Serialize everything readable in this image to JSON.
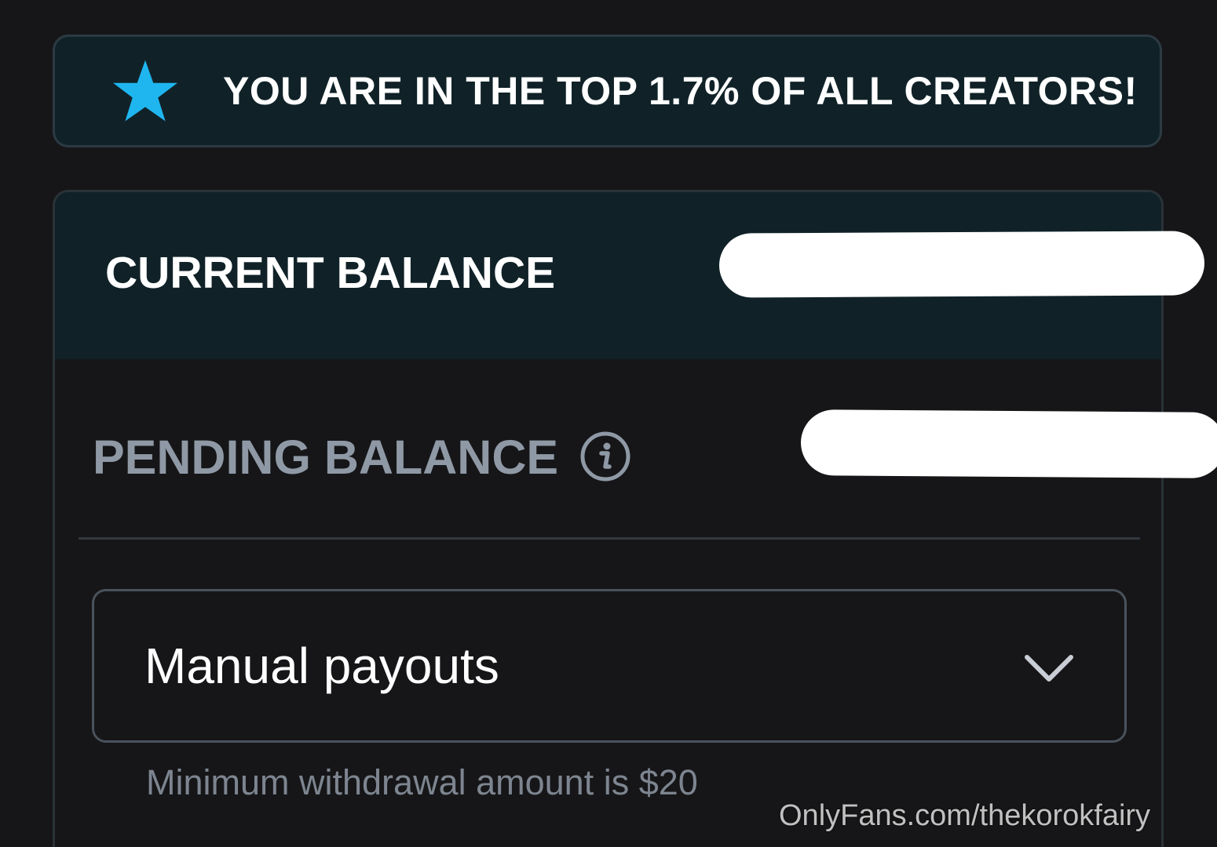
{
  "colors": {
    "background": "#161618",
    "banner_background": "#102228",
    "accent_star": "#1fb6f0",
    "pending_label": "#8f99a6"
  },
  "rank_banner": {
    "icon": "star-icon",
    "text": "YOU ARE IN THE TOP 1.7% OF ALL CREATORS!"
  },
  "balance": {
    "current_label": "CURRENT BALANCE",
    "pending_label": "PENDING BALANCE",
    "pending_info_icon": "info-icon"
  },
  "payout": {
    "selected": "Manual payouts",
    "dropdown_icon": "chevron-down-icon",
    "hint": "Minimum withdrawal amount is $20"
  },
  "watermark": "OnlyFans.com/thekorokfairy"
}
